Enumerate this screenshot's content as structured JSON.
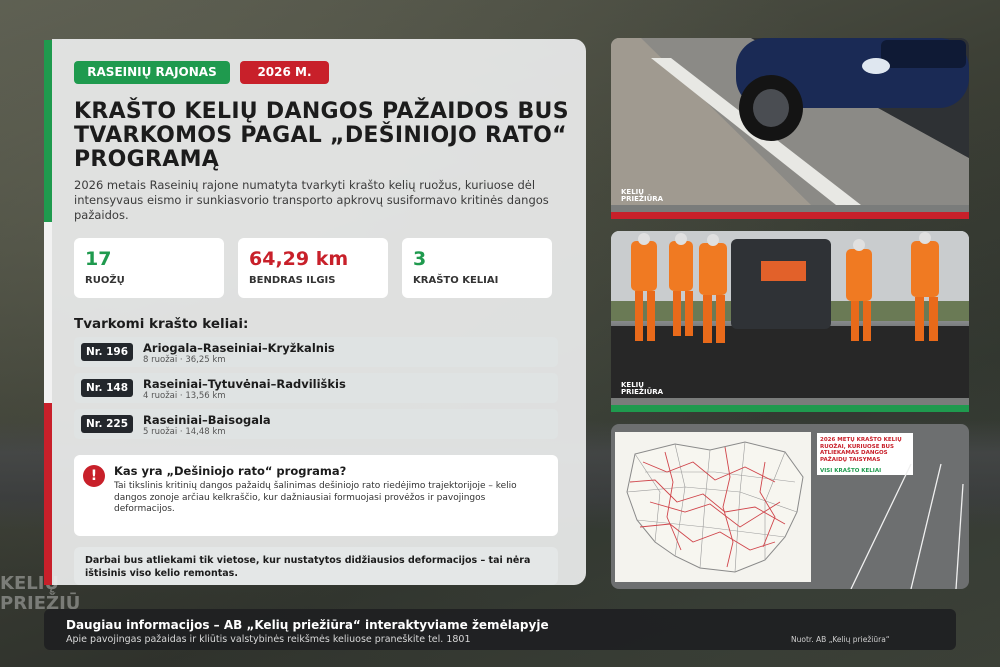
{
  "tags": {
    "region": "RASEINIŲ RAJONAS",
    "year": "2026 M."
  },
  "headline": "KRAŠTO KELIŲ DANGOS PAŽAIDOS BUS TVARKOMOS PAGAL „DEŠINIOJO RATO“ PROGRAMĄ",
  "lead": "2026 metais Raseinių rajone numatyta tvarkyti krašto kelių ruožus, kuriuose dėl intensyvaus eismo ir sunkiasvorio transporto apkrovų susiformavo kritinės dangos pažaidos.",
  "stats": [
    {
      "value": "17",
      "label": "RUOŽŲ"
    },
    {
      "value": "64,29 km",
      "label": "BENDRAS ILGIS"
    },
    {
      "value": "3",
      "label": "KRAŠTO KELIAI"
    }
  ],
  "roads_title": "Tvarkomi krašto keliai:",
  "roads": [
    {
      "number": "Nr. 196",
      "name": "Ariogala–Raseiniai–Kryžkalnis",
      "meta": "8 ruožai · 36,25 km"
    },
    {
      "number": "Nr. 148",
      "name": "Raseiniai–Tytuvėnai–Radviliškis",
      "meta": "4 ruožai · 13,56 km"
    },
    {
      "number": "Nr. 225",
      "name": "Raseiniai–Baisogala",
      "meta": "5 ruožai · 14,48 km"
    }
  ],
  "info": {
    "icon": "!",
    "title": "Kas yra „Dešiniojo rato“ programa?",
    "text": "Tai tikslinis kritinių dangos pažaidų šalinimas dešiniojo rato riedėjimo trajektorijoje – kelio dangos zonoje arčiau kelkraščio, kur dažniausiai formuojasi provėžos ir pavojingos deformacijos."
  },
  "note": "Darbai bus atliekami tik vietose, kur nustatytos didžiausios deformacijos – tai nėra ištisinis viso kelio remontas.",
  "photo_logo": "KELIŲ PRIEŽIŪRA",
  "map_legend": {
    "title": "2026 METŲ KRAŠTO KELIŲ RUOŽAI, KURIUOSE BUS ATLIEKAMAS DANGOS PAŽAIDŲ TAISYMAS",
    "all_roads": "VISI KRAŠTO KELIAI"
  },
  "footer": {
    "title": "Daugiau informacijos – AB „Kelių priežiūra“ interaktyviame žemėlapyje",
    "subtitle": "Apie pavojingas pažaidas ir kliūtis valstybinės reikšmės keliuose praneškite tel. 1801",
    "source": "Nuotr. AB „Kelių priežiūra“"
  },
  "background_logo": "KELIŲ PRIEŽIŪ",
  "colors": {
    "green": "#1f9a4e",
    "red": "#c8202a",
    "dark": "#23272c"
  }
}
